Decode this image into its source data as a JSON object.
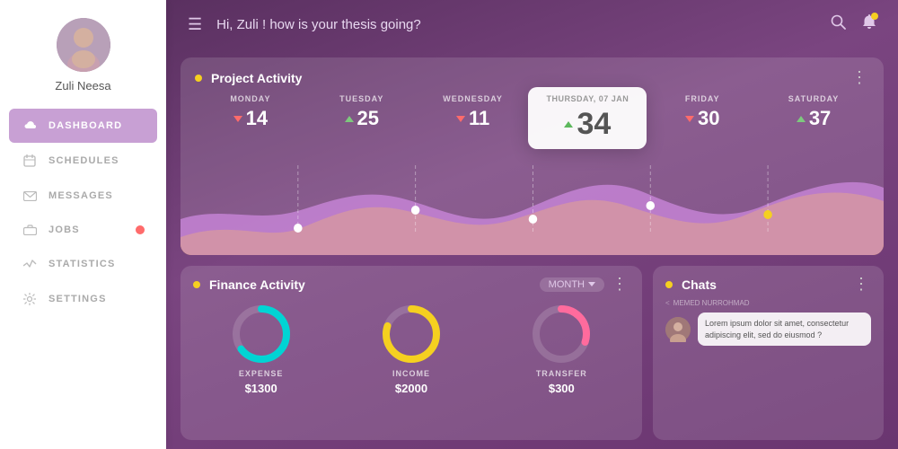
{
  "sidebar": {
    "user": {
      "name": "Zuli Neesa"
    },
    "nav_items": [
      {
        "id": "dashboard",
        "label": "DASHBOARD",
        "icon": "cloud",
        "active": true,
        "badge": false
      },
      {
        "id": "schedules",
        "label": "SCHEDULES",
        "icon": "calendar",
        "active": false,
        "badge": false
      },
      {
        "id": "messages",
        "label": "MESSAGES",
        "icon": "envelope",
        "active": false,
        "badge": false
      },
      {
        "id": "jobs",
        "label": "JOBS",
        "icon": "briefcase",
        "active": false,
        "badge": true
      },
      {
        "id": "statistics",
        "label": "STATISTICS",
        "icon": "activity",
        "active": false,
        "badge": false
      },
      {
        "id": "settings",
        "label": "SETTINGS",
        "icon": "gear",
        "active": false,
        "badge": false
      }
    ]
  },
  "topbar": {
    "greeting": "Hi, Zuli ! how is your thesis going?",
    "search_label": "search",
    "notification_label": "notifications"
  },
  "project_activity": {
    "title": "Project Activity",
    "menu": "...",
    "days": [
      {
        "label": "MONDAY",
        "value": 14,
        "trend": "down",
        "highlight": false
      },
      {
        "label": "TUESDAY",
        "value": 25,
        "trend": "up",
        "highlight": false
      },
      {
        "label": "WEDNESDAY",
        "value": 11,
        "trend": "down",
        "highlight": false
      },
      {
        "label": "THURSDAY, 07 JAN",
        "value": 34,
        "trend": "up",
        "highlight": true
      },
      {
        "label": "FRIDAY",
        "value": 30,
        "trend": "down",
        "highlight": false
      },
      {
        "label": "SATURDAY",
        "value": 37,
        "trend": "up",
        "highlight": false
      }
    ]
  },
  "finance_activity": {
    "title": "Finance Activity",
    "filter": "MONTH",
    "menu": "...",
    "items": [
      {
        "label": "EXPENSE",
        "value": "$1300",
        "color": "#00d4d4",
        "percent": 65
      },
      {
        "label": "INCOME",
        "value": "$2000",
        "color": "#f5d020",
        "percent": 80
      },
      {
        "label": "TRANSFER",
        "value": "$300",
        "color": "#ff6b9d",
        "percent": 30
      }
    ]
  },
  "chats": {
    "title": "Chats",
    "sender": "MEMED NURROHMAD",
    "message": "Lorem ipsum dolor sit amet, consectetur adipiscing elit, sed do eiusmod ?",
    "back_label": "<"
  }
}
